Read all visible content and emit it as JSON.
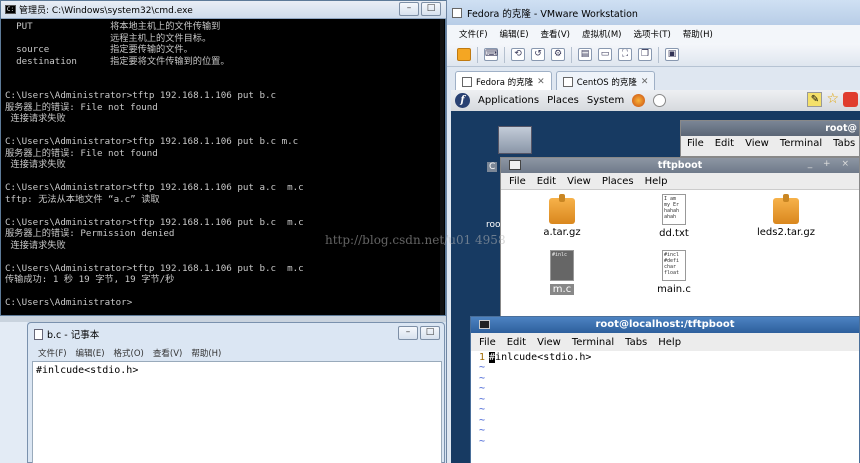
{
  "cmd": {
    "title": "管理员: C:\\Windows\\system32\\cmd.exe",
    "lines": [
      "  PUT              将本地主机上的文件传输到",
      "                   远程主机上的文件目标。",
      "  source           指定要传输的文件。",
      "  destination      指定要将文件传输到的位置。",
      "",
      "",
      "C:\\Users\\Administrator>tftp 192.168.1.106 put b.c",
      "服务器上的错误: File not found",
      " 连接请求失败",
      "",
      "C:\\Users\\Administrator>tftp 192.168.1.106 put b.c m.c",
      "服务器上的错误: File not found",
      " 连接请求失败",
      "",
      "C:\\Users\\Administrator>tftp 192.168.1.106 put a.c  m.c",
      "tftp: 无法从本地文件 “a.c” 读取",
      "",
      "C:\\Users\\Administrator>tftp 192.168.1.106 put b.c  m.c",
      "服务器上的错误: Permission denied",
      " 连接请求失败",
      "",
      "C:\\Users\\Administrator>tftp 192.168.1.106 put b.c  m.c",
      "传输成功: 1 秒 19 字节, 19 字节/秒",
      "",
      "C:\\Users\\Administrator>"
    ]
  },
  "notepad": {
    "title": "b.c - 记事本",
    "menu": [
      "文件(F)",
      "编辑(E)",
      "格式(O)",
      "查看(V)",
      "帮助(H)"
    ],
    "content": "#inlcude<stdio.h>"
  },
  "vmware": {
    "title": "Fedora 的克隆 - VMware Workstation",
    "menu": [
      "文件(F)",
      "编辑(E)",
      "查看(V)",
      "虚拟机(M)",
      "选项卡(T)",
      "帮助(H)"
    ],
    "tabs": [
      {
        "label": "Fedora 的克隆"
      },
      {
        "label": "CentOS 的克隆"
      }
    ]
  },
  "gnome": {
    "panel": [
      "Applications",
      "Places",
      "System"
    ],
    "desktop_label_c": "C",
    "desktop_label_roo": "roo"
  },
  "term_back": {
    "title": "root@",
    "menu": [
      "File",
      "Edit",
      "View",
      "Terminal",
      "Tabs"
    ]
  },
  "nautilus": {
    "title": "tftpboot",
    "menu": [
      "File",
      "Edit",
      "View",
      "Places",
      "Help"
    ],
    "files": [
      {
        "name": "a.tar.gz",
        "kind": "archive"
      },
      {
        "name": "dd.txt",
        "kind": "text",
        "preview": "I am\nmy Er\nhahah\nahah"
      },
      {
        "name": "leds2.tar.gz",
        "kind": "archive"
      },
      {
        "name": "m.c",
        "kind": "source",
        "preview": "#inlc"
      },
      {
        "name": "main.c",
        "kind": "source",
        "preview": "#incl\n#defi\nchar\nfloat"
      }
    ]
  },
  "terminal": {
    "title": "root@localhost:/tftpboot",
    "menu": [
      "File",
      "Edit",
      "View",
      "Terminal",
      "Tabs",
      "Help"
    ],
    "line_number": "1",
    "line_first_char": "#",
    "line_rest": "inlcude<stdio.h>"
  },
  "watermark": "http://blog.csdn.net/u01  4958"
}
